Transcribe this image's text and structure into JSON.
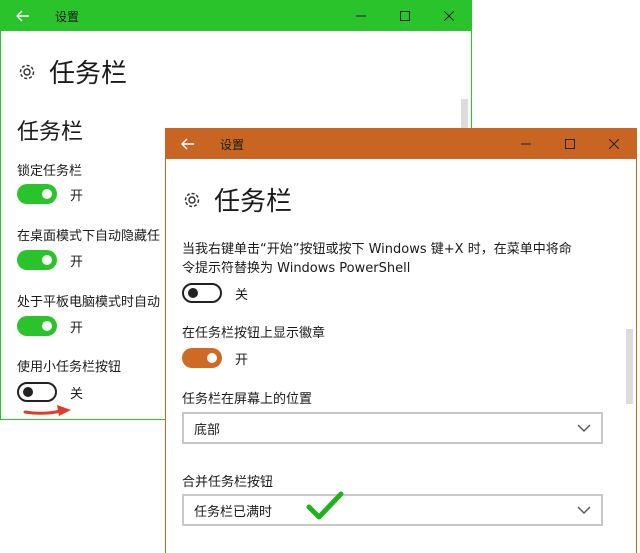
{
  "colors": {
    "green_accent": "#2bc32b",
    "green_toggle": "#2bc32b",
    "orange_accent": "#c96522",
    "orange_toggle": "#cf6a25",
    "arrow_red": "#e03a2a",
    "check_green": "#22b022"
  },
  "back_window": {
    "title": "设置",
    "page_title": "任务栏",
    "section_title": "任务栏",
    "settings": [
      {
        "label": "锁定任务栏",
        "state": "开",
        "on": true
      },
      {
        "label": "在桌面模式下自动隐藏任",
        "state": "开",
        "on": true
      },
      {
        "label": "处于平板电脑模式时自动",
        "state": "开",
        "on": true
      },
      {
        "label": "使用小任务栏按钮",
        "state": "关",
        "on": false
      }
    ]
  },
  "front_window": {
    "title": "设置",
    "page_title": "任务栏",
    "powershell": {
      "label_line1": "当我右键单击“开始”按钮或按下 Windows 键+X 时，在菜单中将命",
      "label_line2": "令提示符替换为 Windows PowerShell",
      "state": "关"
    },
    "badges": {
      "label": "在任务栏按钮上显示徽章",
      "state": "开"
    },
    "position": {
      "label": "任务栏在屏幕上的位置",
      "value": "底部"
    },
    "combine": {
      "label": "合并任务栏按钮",
      "value": "任务栏已满时"
    }
  },
  "icons": {
    "back": "back-arrow-icon",
    "minimize": "minimize-icon",
    "maximize": "maximize-icon",
    "close": "close-icon",
    "gear": "gear-icon",
    "chevron": "chevron-down-icon"
  }
}
